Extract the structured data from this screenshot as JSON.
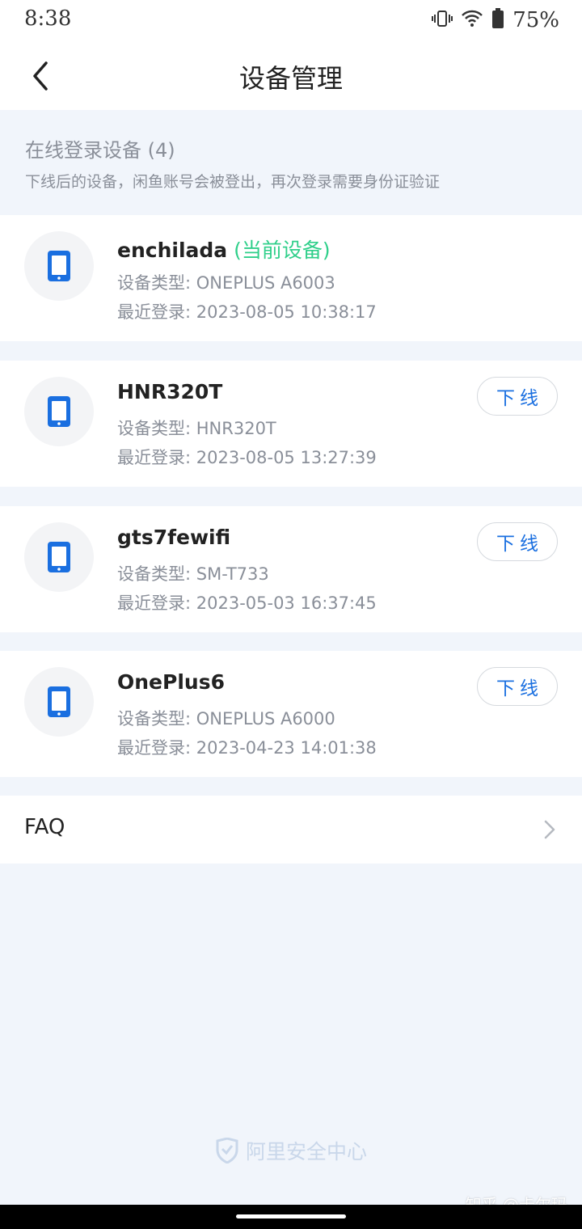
{
  "status_bar": {
    "time": "8:38",
    "battery_percent": "75%"
  },
  "header": {
    "title": "设备管理"
  },
  "section": {
    "title": "在线登录设备 (4)",
    "note": "下线后的设备，闲鱼账号会被登出，再次登录需要身份证验证"
  },
  "devices": [
    {
      "name": "enchilada",
      "current_tag": "(当前设备)",
      "type": "设备类型: ONEPLUS A6003",
      "login": "最近登录: 2023-08-05 10:38:17"
    },
    {
      "name": "HNR320T",
      "type": "设备类型: HNR320T",
      "login": "最近登录: 2023-08-05 13:27:39",
      "action": "下线"
    },
    {
      "name": "gts7fewifi",
      "type": "设备类型: SM-T733",
      "login": "最近登录: 2023-05-03 16:37:45",
      "action": "下线"
    },
    {
      "name": "OnePlus6",
      "type": "设备类型: ONEPLUS A6000",
      "login": "最近登录: 2023-04-23 14:01:38",
      "action": "下线"
    }
  ],
  "faq": {
    "label": "FAQ"
  },
  "footer": {
    "brand": "阿里安全中心"
  },
  "watermark": {
    "text": "知乎 @卡尔玛"
  },
  "colors": {
    "accent_blue": "#1a6fe0",
    "current_green": "#2fcf8a",
    "muted_text": "#8a8f99",
    "background": "#f1f5fb"
  }
}
